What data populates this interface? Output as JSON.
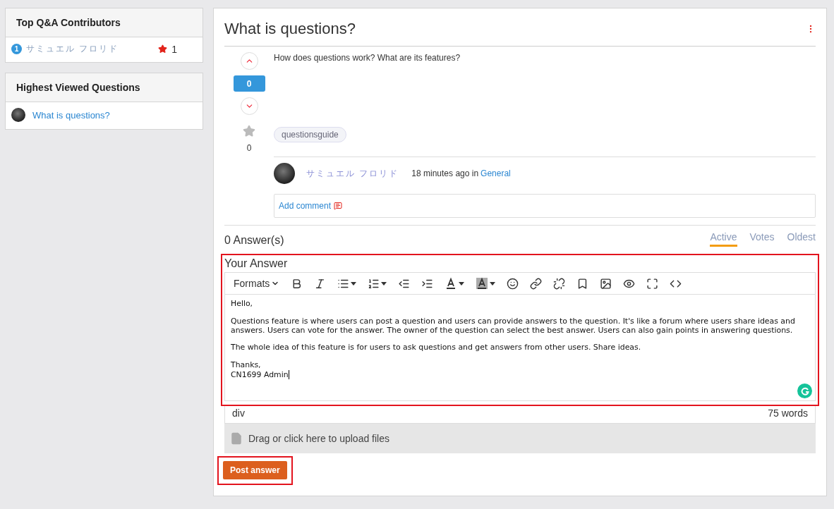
{
  "sidebar": {
    "contributors": {
      "title": "Top Q&A Contributors",
      "items": [
        {
          "rank": "1",
          "name": "サミュエル フロリド",
          "points": "1"
        }
      ]
    },
    "highest_viewed": {
      "title": "Highest Viewed Questions",
      "items": [
        {
          "title": "What is questions?"
        }
      ]
    }
  },
  "question": {
    "title": "What is questions?",
    "body": "How does questions work? What are its features?",
    "votes": "0",
    "favorites": "0",
    "tags": [
      "questionsguide"
    ],
    "author": "サミュエル フロリド",
    "time": "18 minutes ago in",
    "category": "General",
    "add_comment": "Add comment"
  },
  "answers": {
    "count": "0 Answer(s)",
    "sort_tabs": [
      {
        "label": "Active",
        "selected": true
      },
      {
        "label": "Votes",
        "selected": false
      },
      {
        "label": "Oldest",
        "selected": false
      }
    ]
  },
  "editor": {
    "label": "Your Answer",
    "formats": "Formats",
    "paragraphs": [
      "Hello,",
      "Questions feature is where users can post a question and users can provide answers to the question. It's like a forum where users share ideas and answers. Users can vote for the answer. The owner of the question can select the best answer. Users can also gain points in answering questions.",
      "The whole idea of this feature is for users to ask questions and get answers from other users. Share ideas.",
      "Thanks,\nCN1699 Admin"
    ],
    "path": "div",
    "word_count": "75 words",
    "upload": "Drag or click here to upload files"
  },
  "submit": "Post answer"
}
